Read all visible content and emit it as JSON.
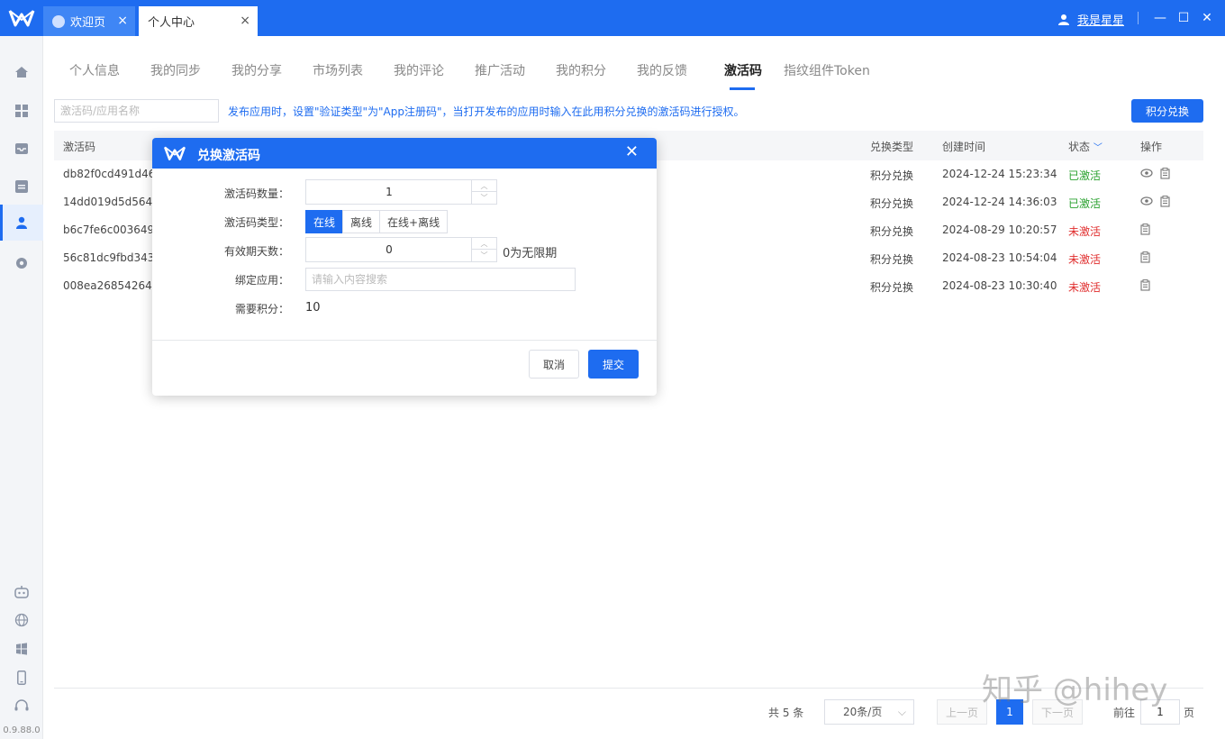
{
  "colors": {
    "accent": "#1e6cf0",
    "active_status": "#2aa12f",
    "inactive_status": "#e02d2d"
  },
  "titlebar": {
    "tabs": [
      {
        "label": "欢迎页",
        "close": "×"
      },
      {
        "label": "个人中心",
        "close": "×"
      }
    ],
    "user_name": "我是星星",
    "window_buttons": {
      "minimize": "—",
      "maximize": "☐",
      "close": "✕"
    }
  },
  "sidebar": {
    "items": [
      "home-icon",
      "apps-icon",
      "inbox-icon",
      "list-icon",
      "user-icon",
      "settings-icon"
    ],
    "bottom_items": [
      "robot-icon",
      "globe-icon",
      "windows-icon",
      "mobile-icon",
      "headset-icon"
    ],
    "version": "0.9.88.0"
  },
  "subtabs": [
    "个人信息",
    "我的同步",
    "我的分享",
    "市场列表",
    "我的评论",
    "推广活动",
    "我的积分",
    "我的反馈",
    "激活码",
    "指纹组件Token"
  ],
  "toolbar": {
    "search_placeholder": "激活码/应用名称",
    "notice": "发布应用时，设置\"验证类型\"为\"App注册码\"，当打开发布的应用时输入在此用积分兑换的激活码进行授权。",
    "redeem_button": "积分兑换"
  },
  "table": {
    "headers": {
      "code": "激活码",
      "type": "兑换类型",
      "created": "创建时间",
      "status": "状态",
      "ops": "操作"
    },
    "rows": [
      {
        "code": "db82f0cd491d465",
        "type": "积分兑换",
        "created": "2024-12-24 15:23:34",
        "status": "已激活",
        "active": true
      },
      {
        "code": "14dd019d5d5646c",
        "type": "积分兑换",
        "created": "2024-12-24 14:36:03",
        "status": "已激活",
        "active": true
      },
      {
        "code": "b6c7fe6c00364917",
        "type": "积分兑换",
        "created": "2024-08-29 10:20:57",
        "status": "未激活",
        "active": false
      },
      {
        "code": "56c81dc9fbd343a0",
        "type": "积分兑换",
        "created": "2024-08-23 10:54:04",
        "status": "未激活",
        "active": false
      },
      {
        "code": "008ea2685426401",
        "type": "积分兑换",
        "created": "2024-08-23 10:30:40",
        "status": "未激活",
        "active": false
      }
    ]
  },
  "pagination": {
    "total": "共 5 条",
    "page_size": "20条/页",
    "prev": "上一页",
    "current": "1",
    "next": "下一页",
    "goto_label": "前往",
    "goto_value": "1",
    "page_suffix": "页"
  },
  "watermark": "知乎 @hihey",
  "modal": {
    "title": "兑换激活码",
    "close": "✕",
    "fields": {
      "quantity_label": "激活码数量：",
      "quantity_value": "1",
      "type_label": "激活码类型：",
      "type_options": [
        "在线",
        "离线",
        "在线+离线"
      ],
      "type_selected": "在线",
      "days_label": "有效期天数：",
      "days_value": "0",
      "days_hint": "0为无限期",
      "app_label": "绑定应用：",
      "app_placeholder": "请输入内容搜索",
      "points_label": "需要积分：",
      "points_value": "10"
    },
    "cancel": "取消",
    "submit": "提交"
  }
}
